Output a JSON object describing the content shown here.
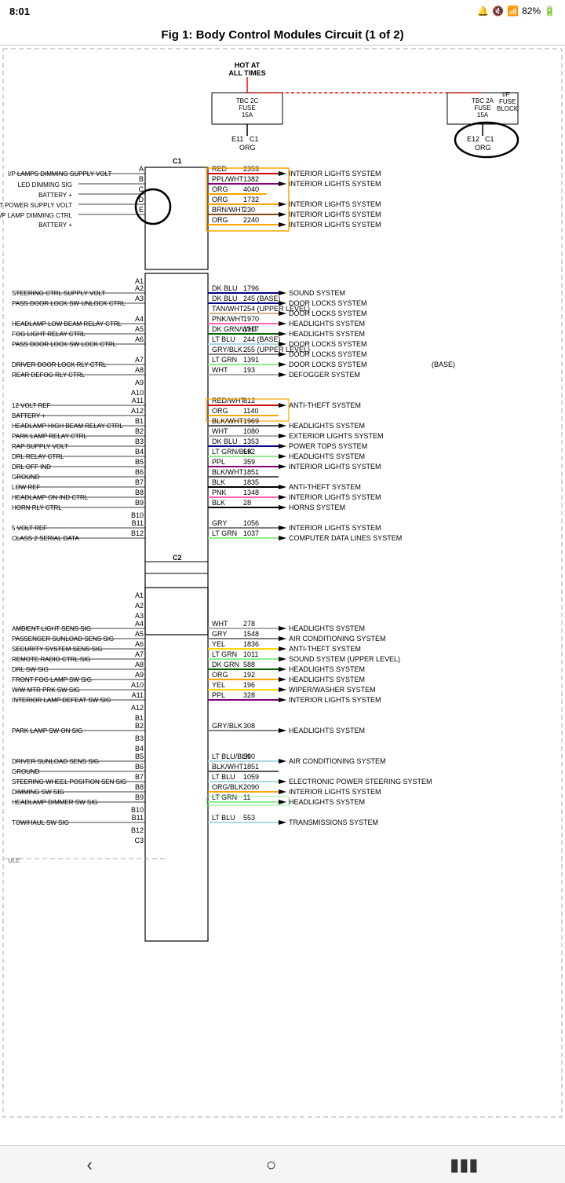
{
  "status": {
    "time": "8:01",
    "battery": "82%",
    "signal": "●●●●"
  },
  "title": "Fig 1: Body Control Modules Circuit (1 of 2)",
  "diagram": {
    "power_label": "HOT AT ALL TIMES",
    "fuses": [
      {
        "id": "TBC2C",
        "value": "TBC 2C",
        "fuse": "FUSE",
        "amps": "15A",
        "conn": "E11",
        "pin": "C1",
        "wire": "ORG"
      },
      {
        "id": "TBC2A",
        "value": "TBC 2A",
        "fuse": "FUSE",
        "amps": "15A",
        "conn": "E12",
        "pin": "C1",
        "wire": "ORG",
        "block": "I/P FUSE BLOCK"
      }
    ],
    "connectors": [
      {
        "name": "C1",
        "pins": [
          {
            "pin": "A",
            "color": "RED",
            "wire": "2353",
            "dest": "INTERIOR LIGHTS SYSTEM",
            "label": "I/P LAMPS DIMMING SUPPLY VOLT"
          },
          {
            "pin": "B",
            "color": "PPL/WHT",
            "wire": "1382",
            "dest": "INTERIOR LIGHTS SYSTEM",
            "label": "LED DIMMING SIG"
          },
          {
            "pin": "C",
            "color": "ORG",
            "wire": "4040",
            "dest": "",
            "label": "BATTERY +"
          },
          {
            "pin": "D",
            "color": "ORG",
            "wire": "1732",
            "dest": "INTERIOR LIGHTS SYSTEM",
            "label": "INADVERTENT POWER SUPPLY VOLT"
          },
          {
            "pin": "E",
            "color": "BRN/WHT",
            "wire": "230",
            "dest": "INTERIOR LIGHTS SYSTEM",
            "label": "I/P LAMP DIMMING CTRL"
          },
          {
            "pin": "",
            "color": "ORG",
            "wire": "2240",
            "dest": "INTERIOR LIGHTS SYSTEM",
            "label": "BATTERY +"
          }
        ]
      }
    ],
    "connector_a": [
      {
        "pin": "A1",
        "color": "",
        "wire": "",
        "dest": "",
        "label": ""
      },
      {
        "pin": "A2",
        "color": "DK BLU",
        "wire": "1796",
        "dest": "SOUND SYSTEM",
        "label": "STEERING CTRL SUPPLY VOLT"
      },
      {
        "pin": "A3",
        "color": "DK BLU",
        "wire": "245",
        "note": "(BASE)",
        "dest": "DOOR LOCKS SYSTEM",
        "label": "PASS DOOR LOCK SW UNLOCK CTRL"
      },
      {
        "pin": "A3",
        "color": "TAN/WHT",
        "wire": "254",
        "note": "(UPPER LEVEL)",
        "dest": "DOOR LOCKS SYSTEM",
        "label": ""
      },
      {
        "pin": "A4",
        "color": "PNK/WHT",
        "wire": "1970",
        "dest": "HEADLIGHTS SYSTEM",
        "label": "HEADLAMP LOW BEAM RELAY CTRL"
      },
      {
        "pin": "A5",
        "color": "DK GRN/WHT",
        "wire": "1317",
        "dest": "HEADLIGHTS SYSTEM",
        "label": "FOG LIGHT RELAY CTRL"
      },
      {
        "pin": "A6",
        "color": "LT BLU",
        "wire": "244",
        "note": "(BASE)",
        "dest": "DOOR LOCKS SYSTEM",
        "label": "PASS DOOR LOCK SW LOCK CTRL"
      },
      {
        "pin": "A6",
        "color": "GRY/BLK",
        "wire": "255",
        "note": "(UPPER LEVEL)",
        "dest": "DOOR LOCKS SYSTEM",
        "label": ""
      },
      {
        "pin": "A7",
        "color": "LT GRN",
        "wire": "1391",
        "dest": "DOOR LOCKS SYSTEM",
        "note2": "(BASE)",
        "label": "DRIVER DOOR LOCK RLY CTRL"
      },
      {
        "pin": "A8",
        "color": "WHT",
        "wire": "193",
        "dest": "DEFOGGER SYSTEM",
        "label": "REAR DEFOG RLY CTRL"
      },
      {
        "pin": "A9",
        "color": "",
        "wire": "",
        "dest": "",
        "label": ""
      },
      {
        "pin": "A10",
        "color": "",
        "wire": "",
        "dest": "",
        "label": ""
      },
      {
        "pin": "A11",
        "color": "RED/WHT",
        "wire": "812",
        "dest": "ANTI-THEFT SYSTEM",
        "label": "12 VOLT REF"
      },
      {
        "pin": "A12",
        "color": "ORG",
        "wire": "1140",
        "dest": "",
        "label": "BATTERY +"
      },
      {
        "pin": "B1",
        "color": "BLK/WHT",
        "wire": "1969",
        "dest": "HEADLIGHTS SYSTEM",
        "label": "HEADLAMP HIGH BEAM RELAY CTRL"
      },
      {
        "pin": "B2",
        "color": "WHT",
        "wire": "1080",
        "dest": "EXTERIOR LIGHTS SYSTEM",
        "label": "PARK LAMP RELAY CTRL"
      },
      {
        "pin": "B3",
        "color": "DK BLU",
        "wire": "1353",
        "dest": "POWER TOPS SYSTEM",
        "label": "RAP SUPPLY VOLT"
      },
      {
        "pin": "B4",
        "color": "LT GRN/BLK",
        "wire": "592",
        "dest": "HEADLIGHTS SYSTEM",
        "label": "DRL RELAY CTRL"
      },
      {
        "pin": "B5",
        "color": "PPL",
        "wire": "359",
        "dest": "INTERIOR LIGHTS SYSTEM",
        "label": "DRL OFF IND"
      },
      {
        "pin": "B6",
        "color": "BLK/WHT",
        "wire": "1851",
        "dest": "",
        "label": "GROUND"
      },
      {
        "pin": "B7",
        "color": "BLK",
        "wire": "1835",
        "dest": "ANTI-THEFT SYSTEM",
        "label": "LOW REF"
      },
      {
        "pin": "B8",
        "color": "PNK",
        "wire": "1348",
        "dest": "INTERIOR LIGHTS SYSTEM",
        "label": "HEADLAMP ON IND CTRL"
      },
      {
        "pin": "B9",
        "color": "BLK",
        "wire": "28",
        "dest": "HORNS SYSTEM",
        "label": "HORN RLY CTRL"
      },
      {
        "pin": "B10",
        "color": "",
        "wire": "",
        "dest": "",
        "label": ""
      },
      {
        "pin": "B11",
        "color": "GRY",
        "wire": "1056",
        "dest": "INTERIOR LIGHTS SYSTEM",
        "label": "5 VOLT REF"
      },
      {
        "pin": "B12",
        "color": "LT GRN",
        "wire": "1037",
        "dest": "COMPUTER DATA LINES SYSTEM",
        "label": "CLASS 2 SERIAL DATA"
      }
    ],
    "connector_c2": {
      "name": "C2"
    },
    "connector_c_pins": [
      {
        "pin": "A1",
        "color": "",
        "wire": "",
        "dest": "",
        "label": ""
      },
      {
        "pin": "A2",
        "color": "",
        "wire": "",
        "dest": "",
        "label": ""
      },
      {
        "pin": "A3",
        "color": "",
        "wire": "",
        "dest": "",
        "label": ""
      },
      {
        "pin": "A4",
        "color": "WHT",
        "wire": "278",
        "dest": "HEADLIGHTS SYSTEM",
        "label": "AMBIENT LIGHT SENS SIG"
      },
      {
        "pin": "A5",
        "color": "GRY",
        "wire": "1548",
        "dest": "AIR CONDITIONING SYSTEM",
        "label": "PASSENGER SUNLOAD SENS SIG"
      },
      {
        "pin": "A6",
        "color": "YEL",
        "wire": "1836",
        "dest": "ANTI-THEFT SYSTEM",
        "label": "SECURITY SYSTEM SENS SIG"
      },
      {
        "pin": "A7",
        "color": "LT GRN",
        "wire": "1011",
        "dest": "SOUND SYSTEM (UPPER LEVEL)",
        "label": "REMOTE RADIO CTRL SIG"
      },
      {
        "pin": "A8",
        "color": "DK GRN",
        "wire": "588",
        "dest": "HEADLIGHTS SYSTEM",
        "label": "DRL SW SIG"
      },
      {
        "pin": "A9",
        "color": "ORG",
        "wire": "192",
        "dest": "HEADLIGHTS SYSTEM",
        "label": "FRONT FOG LAMP SW SIG"
      },
      {
        "pin": "A10",
        "color": "YEL",
        "wire": "196",
        "dest": "WIPER/WASHER SYSTEM",
        "label": "W/W MTR PRK SW SIG"
      },
      {
        "pin": "A11",
        "color": "PPL",
        "wire": "328",
        "dest": "INTERIOR LIGHTS SYSTEM",
        "label": "INTERIOR LAMP DEFEAT SW SIG"
      },
      {
        "pin": "A12",
        "color": "",
        "wire": "",
        "dest": "",
        "label": ""
      },
      {
        "pin": "B1",
        "color": "",
        "wire": "",
        "dest": "",
        "label": ""
      },
      {
        "pin": "B2",
        "color": "GRY/BLK",
        "wire": "308",
        "dest": "HEADLIGHTS SYSTEM",
        "label": "PARK LAMP SW ON SIG"
      },
      {
        "pin": "B3",
        "color": "",
        "wire": "",
        "dest": "",
        "label": ""
      },
      {
        "pin": "B4",
        "color": "",
        "wire": "",
        "dest": "",
        "label": ""
      },
      {
        "pin": "B5",
        "color": "LT BLU/BLK",
        "wire": "590",
        "dest": "AIR CONDITIONING SYSTEM",
        "label": "DRIVER SUNLOAD SENS SIG"
      },
      {
        "pin": "B6",
        "color": "BLK/WHT",
        "wire": "1851",
        "dest": "",
        "label": "GROUND"
      },
      {
        "pin": "B7",
        "color": "LT BLU",
        "wire": "1059",
        "dest": "ELECTRONIC POWER STEERING SYSTEM",
        "label": "STEERING WHEEL POSITION SEN SIG"
      },
      {
        "pin": "B8",
        "color": "ORG/BLK",
        "wire": "2090",
        "dest": "INTERIOR LIGHTS SYSTEM",
        "label": "DIMMING SW SIG"
      },
      {
        "pin": "B9",
        "color": "LT GRN",
        "wire": "11",
        "dest": "HEADLIGHTS SYSTEM",
        "label": "HEADLAMP DIMMER SW SIG"
      },
      {
        "pin": "B10",
        "color": "",
        "wire": "",
        "dest": "",
        "label": ""
      },
      {
        "pin": "B11",
        "color": "LT BLU",
        "wire": "553",
        "dest": "TRANSMISSIONS SYSTEM",
        "label": "TOW/HAUL SW SIG"
      },
      {
        "pin": "B12",
        "color": "",
        "wire": "",
        "dest": "",
        "label": ""
      },
      {
        "pin": "C3",
        "color": "",
        "wire": "",
        "dest": "",
        "label": ""
      }
    ]
  },
  "nav": {
    "back": "‹",
    "home": "○",
    "recent": "▮▮▮"
  }
}
